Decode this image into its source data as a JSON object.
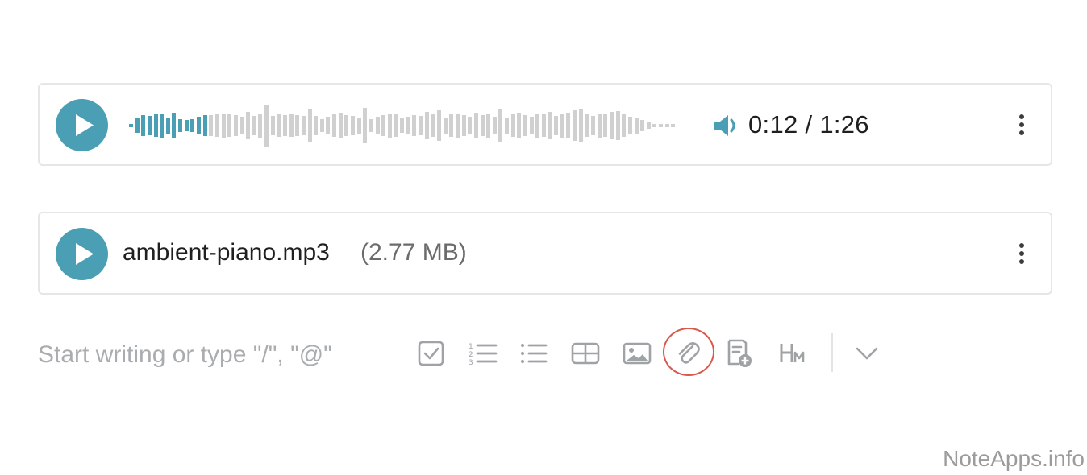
{
  "audio_player": {
    "current_time": "0:12",
    "separator": "/",
    "duration": "1:26",
    "progress_fraction": 0.14,
    "accent_color": "#4a9fb5",
    "played_color": "#4a9fb5",
    "unplayed_color": "#d0d0d0",
    "icons": [
      "play-icon",
      "volume-icon",
      "more-vertical-icon"
    ]
  },
  "attachment": {
    "file_name": "ambient-piano.mp3",
    "file_size": "(2.77 MB)",
    "icons": [
      "play-icon",
      "more-vertical-icon"
    ]
  },
  "editor": {
    "placeholder": "Start writing or type \"/\", \"@\""
  },
  "toolbar": {
    "items": [
      "checkbox-icon",
      "numbered-list-icon",
      "bullet-list-icon",
      "table-icon",
      "image-icon",
      "attachment-icon",
      "add-page-icon",
      "heading-icon",
      "chevron-down-icon"
    ],
    "highlighted": "attachment-icon",
    "highlight_color": "#d9594c"
  },
  "watermark": {
    "text": "NoteApps.info"
  }
}
